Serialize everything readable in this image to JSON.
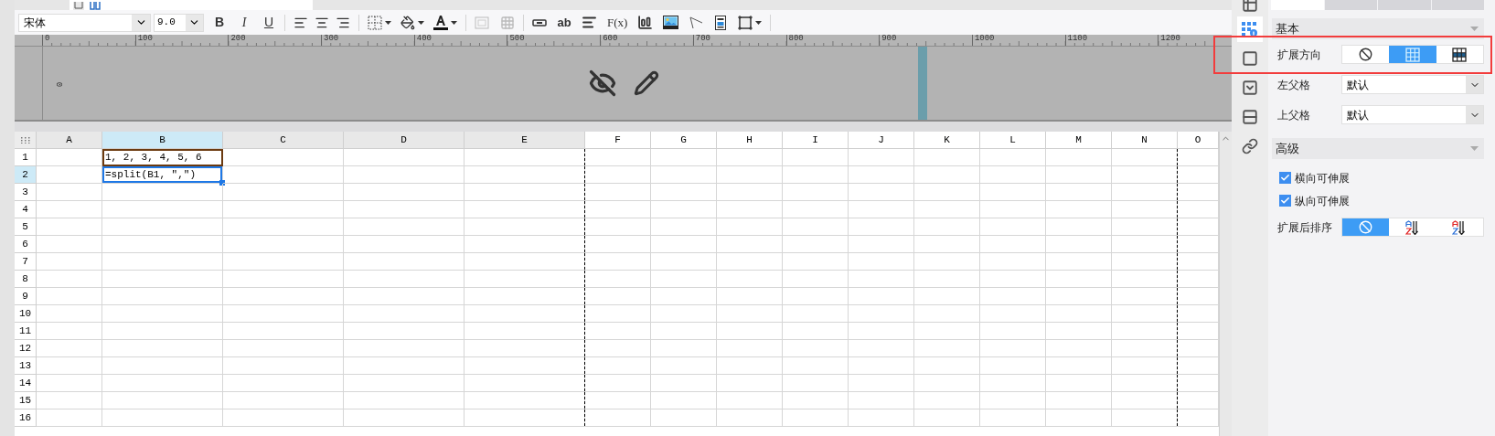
{
  "toolbar": {
    "font": "宋体",
    "font_size": "9.0",
    "style_buttons": [
      {
        "kind": "bold",
        "label": "B"
      },
      {
        "kind": "italic",
        "label": "I"
      },
      {
        "kind": "underline",
        "label": "U"
      }
    ],
    "text_button": "ab",
    "formula_button": "F(x)"
  },
  "ruler": {
    "vertical_label": "0",
    "labels": [
      "0",
      "100",
      "200",
      "300",
      "400",
      "500",
      "600",
      "700",
      "800",
      "900",
      "1000",
      "1100",
      "1200"
    ]
  },
  "sheet": {
    "columns": [
      {
        "label": "A",
        "selected": false,
        "shaded": true,
        "page_break": false
      },
      {
        "label": "B",
        "selected": true,
        "shaded": true,
        "page_break": false
      },
      {
        "label": "C",
        "selected": false,
        "shaded": true,
        "page_break": false
      },
      {
        "label": "D",
        "selected": false,
        "shaded": true,
        "page_break": false
      },
      {
        "label": "E",
        "selected": false,
        "shaded": true,
        "page_break": true
      },
      {
        "label": "F",
        "selected": false,
        "shaded": false,
        "page_break": false
      },
      {
        "label": "G",
        "selected": false,
        "shaded": false,
        "page_break": false
      },
      {
        "label": "H",
        "selected": false,
        "shaded": false,
        "page_break": false
      },
      {
        "label": "I",
        "selected": false,
        "shaded": false,
        "page_break": false
      },
      {
        "label": "J",
        "selected": false,
        "shaded": false,
        "page_break": false
      },
      {
        "label": "K",
        "selected": false,
        "shaded": false,
        "page_break": false
      },
      {
        "label": "L",
        "selected": false,
        "shaded": false,
        "page_break": false
      },
      {
        "label": "M",
        "selected": false,
        "shaded": false,
        "page_break": false
      },
      {
        "label": "N",
        "selected": false,
        "shaded": false,
        "page_break": true
      },
      {
        "label": "O",
        "selected": false,
        "shaded": false,
        "page_break": false
      }
    ],
    "rows": [
      {
        "label": "1",
        "selected": false,
        "cells": [
          {},
          {
            "text": "1, 2, 3, 4, 5, 6",
            "selected": false,
            "referenced": true
          }
        ]
      },
      {
        "label": "2",
        "selected": true,
        "cells": [
          {},
          {
            "text": "=split(B1, \",\")",
            "selected": true
          }
        ]
      },
      {
        "label": "3",
        "selected": false
      },
      {
        "label": "4",
        "selected": false
      },
      {
        "label": "5",
        "selected": false
      },
      {
        "label": "6",
        "selected": false
      },
      {
        "label": "7",
        "selected": false
      },
      {
        "label": "8",
        "selected": false
      },
      {
        "label": "9",
        "selected": false
      },
      {
        "label": "10",
        "selected": false
      },
      {
        "label": "11",
        "selected": false
      },
      {
        "label": "12",
        "selected": false
      },
      {
        "label": "13",
        "selected": false
      },
      {
        "label": "14",
        "selected": false
      },
      {
        "label": "15",
        "selected": false
      },
      {
        "label": "16",
        "selected": false
      }
    ]
  },
  "side_toolbar": [
    {
      "selected": false
    },
    {
      "selected": true
    },
    {
      "selected": false
    },
    {
      "selected": false
    },
    {
      "selected": false
    },
    {
      "selected": false
    }
  ],
  "panel": {
    "tabs": [
      {
        "selected": true
      },
      {
        "selected": false
      },
      {
        "selected": false
      },
      {
        "selected": false
      }
    ],
    "sections": [
      {
        "title": "基本",
        "rows": [
          {
            "kind": "segmented",
            "label": "扩展方向",
            "options": [
              {
                "selected": false
              },
              {
                "selected": true
              },
              {
                "selected": false
              }
            ]
          },
          {
            "kind": "select",
            "label": "左父格",
            "value": "默认"
          },
          {
            "kind": "select",
            "label": "上父格",
            "value": "默认"
          }
        ]
      },
      {
        "title": "高级",
        "rows": [
          {
            "kind": "checkbox",
            "label": "横向可伸展",
            "checked": true
          },
          {
            "kind": "checkbox",
            "label": "纵向可伸展",
            "checked": true
          },
          {
            "kind": "segmented",
            "label": "扩展后排序",
            "options": [
              {
                "selected": true
              },
              {
                "selected": false
              },
              {
                "selected": false
              }
            ]
          }
        ]
      }
    ]
  }
}
